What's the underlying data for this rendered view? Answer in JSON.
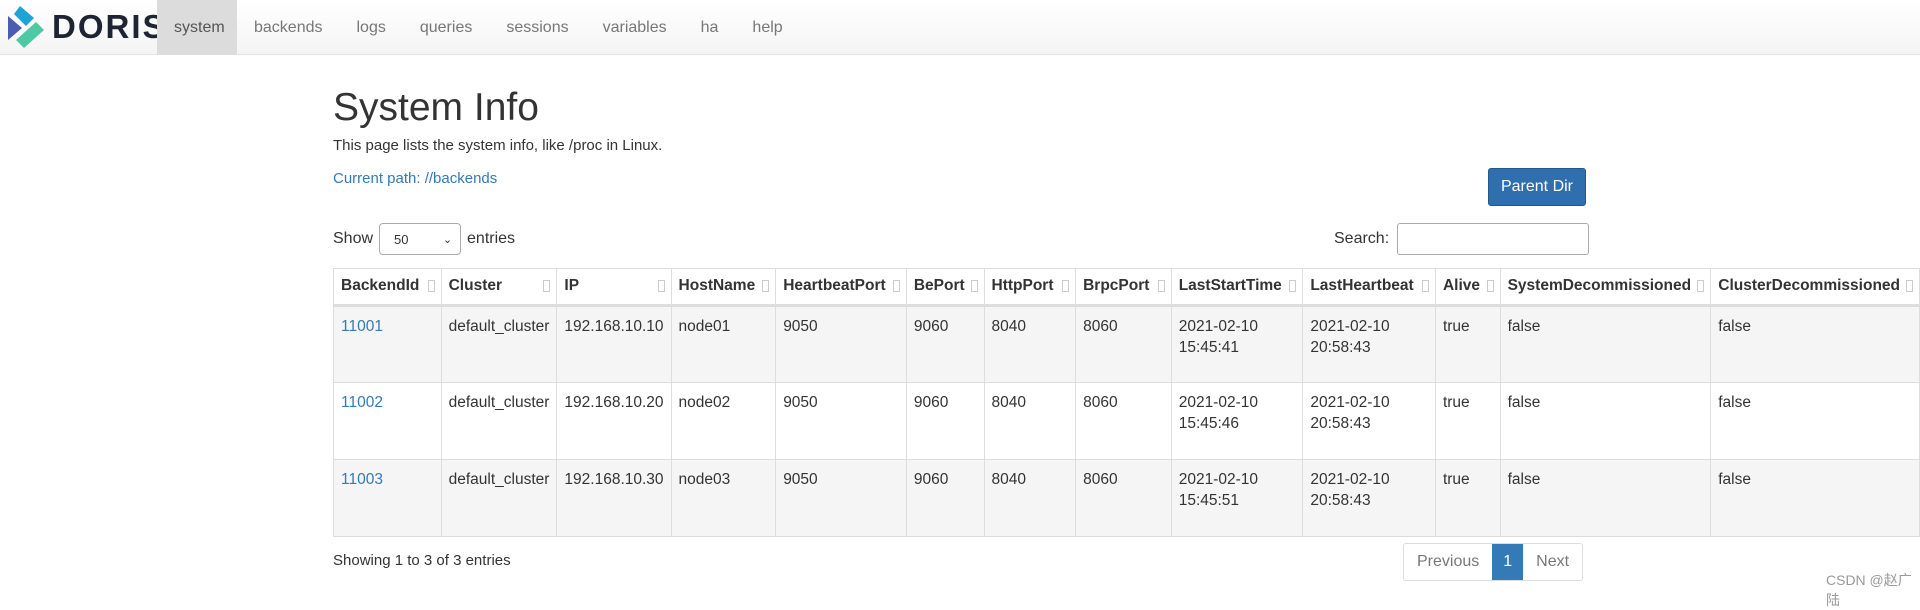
{
  "nav": {
    "logo": "DORIS",
    "items": [
      "system",
      "backends",
      "logs",
      "queries",
      "sessions",
      "variables",
      "ha",
      "help"
    ],
    "active": "system"
  },
  "page": {
    "title": "System Info",
    "description": "This page lists the system info, like /proc in Linux.",
    "current_path": "Current path: //backends",
    "parent_dir_label": "Parent Dir"
  },
  "controls": {
    "show_label": "Show",
    "entries_value": "50",
    "entries_label": "entries",
    "search_label": "Search:",
    "search_value": ""
  },
  "table": {
    "columns": [
      "BackendId",
      "Cluster",
      "IP",
      "HostName",
      "HeartbeatPort",
      "BePort",
      "HttpPort",
      "BrpcPort",
      "LastStartTime",
      "LastHeartbeat",
      "Alive",
      "SystemDecommissioned",
      "ClusterDecommissioned"
    ],
    "rows": [
      [
        "11001",
        "default_cluster",
        "192.168.10.10",
        "node01",
        "9050",
        "9060",
        "8040",
        "8060",
        "2021-02-10 15:45:41",
        "2021-02-10 20:58:43",
        "true",
        "false",
        "false"
      ],
      [
        "11002",
        "default_cluster",
        "192.168.10.20",
        "node02",
        "9050",
        "9060",
        "8040",
        "8060",
        "2021-02-10 15:45:46",
        "2021-02-10 20:58:43",
        "true",
        "false",
        "false"
      ],
      [
        "11003",
        "default_cluster",
        "192.168.10.30",
        "node03",
        "9050",
        "9060",
        "8040",
        "8060",
        "2021-02-10 15:45:51",
        "2021-02-10 20:58:43",
        "true",
        "false",
        "false"
      ]
    ]
  },
  "footer": {
    "info": "Showing 1 to 3 of 3 entries",
    "previous": "Previous",
    "page": "1",
    "next": "Next"
  },
  "watermark": "CSDN @赵广陆",
  "colors": {
    "accent": "#337ab7",
    "button": "#2f6fad"
  }
}
